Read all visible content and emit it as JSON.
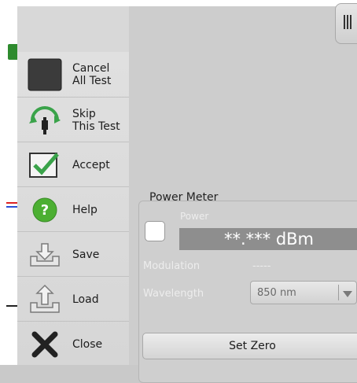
{
  "menu": {
    "items": [
      {
        "label": "Cancel\nAll Test",
        "icon": "cancel-square-icon"
      },
      {
        "label": "Skip\nThis Test",
        "icon": "skip-arc-icon"
      },
      {
        "label": "Accept",
        "icon": "checkmark-box-icon"
      },
      {
        "label": "Help",
        "icon": "question-circle-icon"
      },
      {
        "label": "Save",
        "icon": "tray-down-arrow-icon"
      },
      {
        "label": "Load",
        "icon": "tray-up-arrow-icon"
      },
      {
        "label": "Close",
        "icon": "x-close-icon"
      }
    ]
  },
  "power_meter": {
    "title": "Power Meter",
    "power_label": "Power",
    "power_value": "**.*** dBm",
    "modulation_label": "Modulation",
    "modulation_value": "-----",
    "wavelength_label": "Wavelength",
    "wavelength_value": "850 nm",
    "set_zero_label": "Set Zero"
  },
  "colors": {
    "accent_green": "#3aa34a",
    "help_green": "#4caf32",
    "dark_gray": "#3a3a3a"
  }
}
